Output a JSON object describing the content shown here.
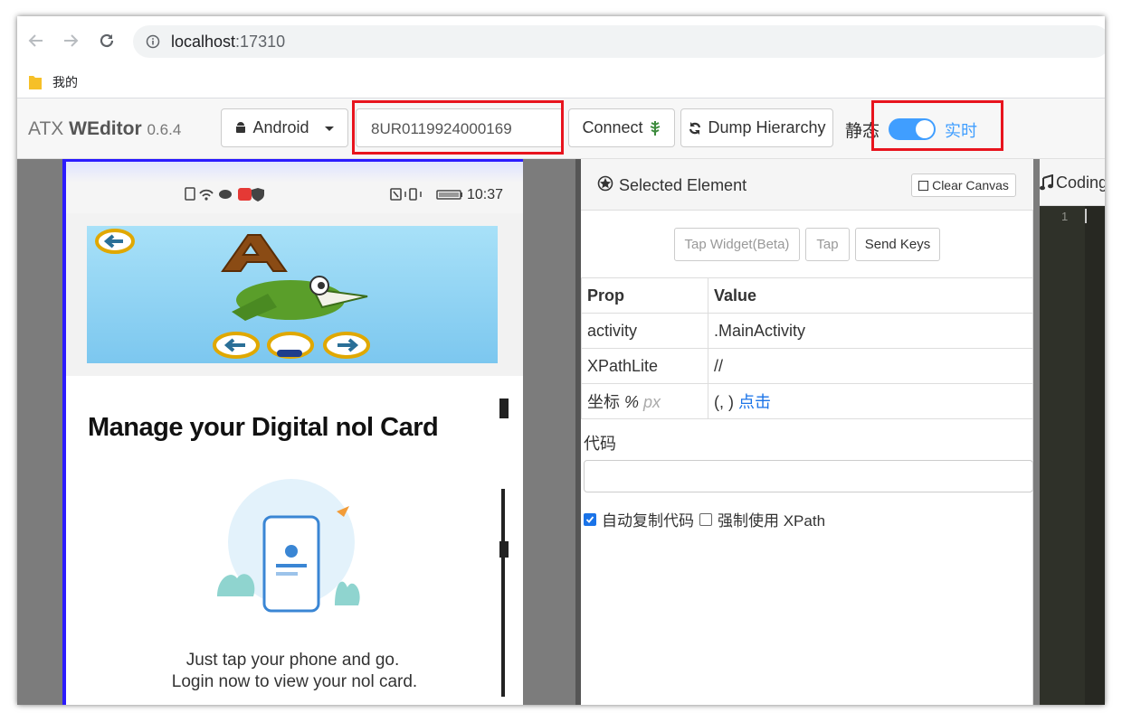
{
  "browser": {
    "url_host": "localhost",
    "url_port": ":17310",
    "bookmark_label": "我的"
  },
  "toolbar": {
    "brand_prefix": "ATX",
    "brand_name": "WEditor",
    "version": "0.6.4",
    "platform_label": "Android",
    "serial_value": "8UR0119924000169",
    "connect_label": "Connect",
    "dump_label": "Dump Hierarchy",
    "static_label": "静态",
    "live_label": "实时",
    "toggle_on": true
  },
  "device": {
    "status_time": "10:37",
    "card_title": "Manage your Digital nol Card",
    "card_line1": "Just tap your phone and go.",
    "card_line2": "Login now to view your nol card."
  },
  "panel": {
    "title": "Selected Element",
    "clear_label": "Clear Canvas",
    "tap_widget_label": "Tap Widget(Beta)",
    "tap_label": "Tap",
    "send_keys_label": "Send Keys",
    "prop_header": "Prop",
    "value_header": "Value",
    "rows": [
      {
        "prop": "activity",
        "value": ".MainActivity"
      },
      {
        "prop": "XPathLite",
        "value": "//"
      }
    ],
    "coord_prop": "坐标",
    "coord_pct": "%",
    "coord_px": "px",
    "coord_value": "(, )",
    "coord_link": "点击",
    "code_label": "代码",
    "auto_copy_label": "自动复制代码",
    "auto_copy_checked": true,
    "force_xpath_label": "强制使用 XPath",
    "force_xpath_checked": false
  },
  "code_panel": {
    "tab_label": "Coding",
    "line_number": "1"
  },
  "colors": {
    "highlight_box": "#e8141e",
    "toggle_accent": "#409eff",
    "device_border": "#2b1bff"
  }
}
